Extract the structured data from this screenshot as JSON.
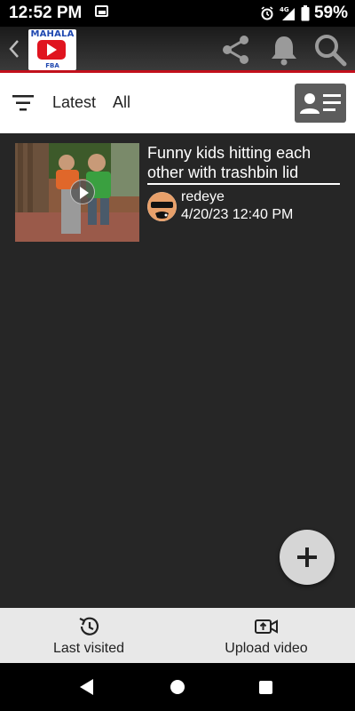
{
  "status_bar": {
    "time": "12:52 PM",
    "network": "4G",
    "battery": "59%"
  },
  "header": {
    "logo_top": "MAHALA",
    "logo_bottom": "FBA",
    "icons": [
      "back-chevron-icon",
      "share-icon",
      "bell-icon",
      "search-icon"
    ]
  },
  "filter_bar": {
    "sort_label": "Latest",
    "scope_label": "All"
  },
  "videos": [
    {
      "title": "Funny kids hitting each other with trashbin lid",
      "author": "redeye",
      "date": "4/20/23 12:40 PM"
    }
  ],
  "bottom_nav": {
    "last_visited": "Last visited",
    "upload_video": "Upload video"
  },
  "colors": {
    "accent_red": "#c2101c",
    "content_bg": "#262626",
    "nav_bg": "#e8e8e8"
  }
}
